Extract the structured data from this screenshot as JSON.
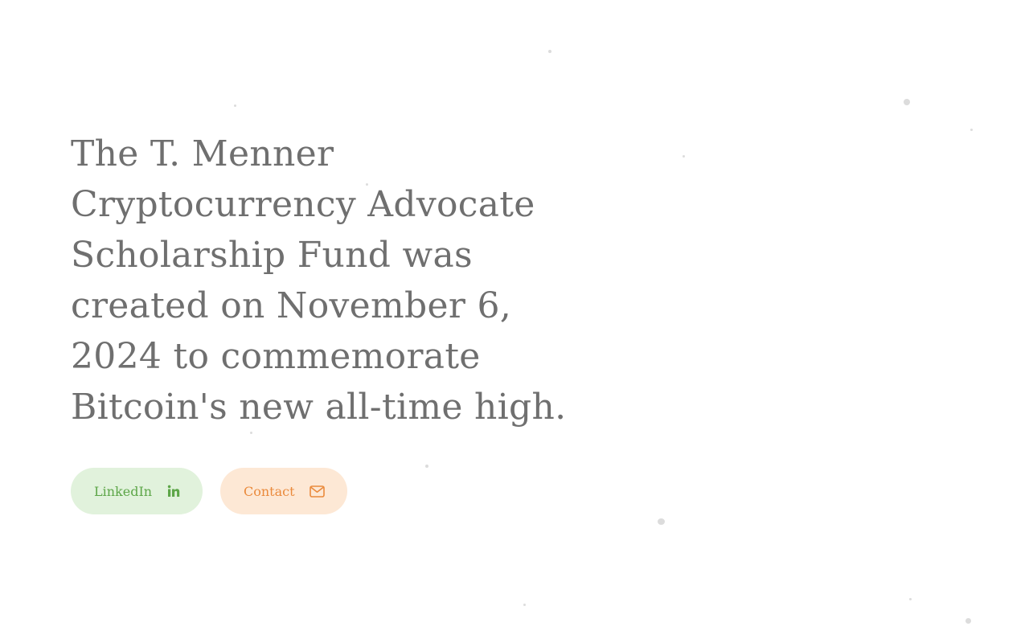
{
  "hero": {
    "headline": "The T. Menner Cryptocurrency Advocate Scholarship Fund was created on November 6, 2024 to commemorate Bitcoin's new all-time high."
  },
  "actions": {
    "linkedin_label": "LinkedIn",
    "linkedin_icon": "linkedin-icon",
    "contact_label": "Contact",
    "contact_icon": "envelope-icon"
  },
  "colors": {
    "headline_text": "#6f6f6f",
    "linkedin_bg": "#e1f2dc",
    "linkedin_text": "#5da648",
    "contact_bg": "#fde8d5",
    "contact_text": "#ea8a3c"
  }
}
